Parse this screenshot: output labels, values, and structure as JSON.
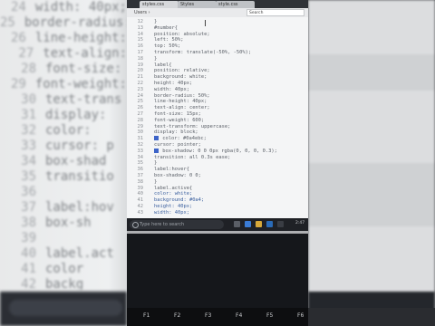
{
  "browser": {
    "tab1_label": "styles.css",
    "tab2_label": "Styles",
    "tab3_label": "style.css",
    "breadcrumb": "Users ›",
    "search_placeholder": "Search"
  },
  "editor": {
    "lines": [
      {
        "num": "12",
        "text": "}",
        "highlight": false,
        "swatch": false
      },
      {
        "num": "13",
        "text": "#number{",
        "highlight": false,
        "swatch": false
      },
      {
        "num": "14",
        "text": "  position: absolute;",
        "highlight": false,
        "swatch": false
      },
      {
        "num": "15",
        "text": "  left: 50%;",
        "highlight": false,
        "swatch": false
      },
      {
        "num": "16",
        "text": "  top: 50%;",
        "highlight": false,
        "swatch": false
      },
      {
        "num": "17",
        "text": "  transform: translate(-50%, -50%);",
        "highlight": false,
        "swatch": false
      },
      {
        "num": "18",
        "text": "}",
        "highlight": false,
        "swatch": false
      },
      {
        "num": "19",
        "text": "label{",
        "highlight": false,
        "swatch": false
      },
      {
        "num": "20",
        "text": "  position: relative;",
        "highlight": false,
        "swatch": false
      },
      {
        "num": "21",
        "text": "  background: white;",
        "highlight": false,
        "swatch": false
      },
      {
        "num": "22",
        "text": "  height: 40px;",
        "highlight": false,
        "swatch": false
      },
      {
        "num": "23",
        "text": "  width: 40px;",
        "highlight": false,
        "swatch": false
      },
      {
        "num": "24",
        "text": "  border-radius: 50%;",
        "highlight": false,
        "swatch": false
      },
      {
        "num": "25",
        "text": "  line-height: 40px;",
        "highlight": false,
        "swatch": false
      },
      {
        "num": "26",
        "text": "  text-align: center;",
        "highlight": false,
        "swatch": false
      },
      {
        "num": "27",
        "text": "  font-size: 15px;",
        "highlight": false,
        "swatch": false
      },
      {
        "num": "28",
        "text": "  font-weight: 600;",
        "highlight": false,
        "swatch": false
      },
      {
        "num": "29",
        "text": "  text-transform: uppercase;",
        "highlight": false,
        "swatch": false
      },
      {
        "num": "30",
        "text": "  display: block;",
        "highlight": false,
        "swatch": false
      },
      {
        "num": "31",
        "text": "  color: #0a4ebc;",
        "highlight": false,
        "swatch": true
      },
      {
        "num": "32",
        "text": "  cursor: pointer;",
        "highlight": false,
        "swatch": false
      },
      {
        "num": "33",
        "text": "  box-shadow: 0 0 0px rgba(0, 0, 0, 0.3);",
        "highlight": false,
        "swatch": true
      },
      {
        "num": "34",
        "text": "  transition: all 0.3s ease;",
        "highlight": false,
        "swatch": false
      },
      {
        "num": "35",
        "text": "}",
        "highlight": false,
        "swatch": false
      },
      {
        "num": "36",
        "text": "label:hover{",
        "highlight": false,
        "swatch": false
      },
      {
        "num": "37",
        "text": "  box-shadow: 0 0;",
        "highlight": false,
        "swatch": false
      },
      {
        "num": "38",
        "text": "}",
        "highlight": false,
        "swatch": false
      },
      {
        "num": "39",
        "text": "label.active{",
        "highlight": false,
        "swatch": false
      },
      {
        "num": "40",
        "text": "  color: white;",
        "highlight": true,
        "swatch": false
      },
      {
        "num": "41",
        "text": "  background: #0a4;",
        "highlight": true,
        "swatch": false
      },
      {
        "num": "42",
        "text": "  height: 40px;",
        "highlight": true,
        "swatch": false
      },
      {
        "num": "43",
        "text": "  width: 40px;",
        "highlight": true,
        "swatch": false
      }
    ]
  },
  "background_code": {
    "lines": [
      {
        "num": "24",
        "text": "width: 40px;"
      },
      {
        "num": "25",
        "text": "border-radius:"
      },
      {
        "num": "26",
        "text": "line-height:"
      },
      {
        "num": "27",
        "text": "text-align:"
      },
      {
        "num": "28",
        "text": "font-size:"
      },
      {
        "num": "29",
        "text": "font-weight:"
      },
      {
        "num": "30",
        "text": "text-trans"
      },
      {
        "num": "31",
        "text": "display:"
      },
      {
        "num": "32",
        "text": "color: "
      },
      {
        "num": "33",
        "text": "cursor: p"
      },
      {
        "num": "34",
        "text": "box-shad"
      },
      {
        "num": "35",
        "text": "transitio"
      },
      {
        "num": "36",
        "text": ""
      },
      {
        "num": "37",
        "text": "label:hov"
      },
      {
        "num": "38",
        "text": "  box-sh"
      },
      {
        "num": "39",
        "text": ""
      },
      {
        "num": "40",
        "text": "label.act"
      },
      {
        "num": "41",
        "text": "  color"
      },
      {
        "num": "42",
        "text": "  backg"
      },
      {
        "num": "43",
        "text": "  heig"
      }
    ]
  },
  "taskbar": {
    "search_text": "Type here to search",
    "time": "2:47"
  },
  "fn_keys": [
    "F1",
    "F2",
    "F3",
    "F4",
    "F5",
    "F6"
  ],
  "colors": {
    "swatch_blue": "#3d64c8",
    "editor_bg": "#f4f5f6",
    "taskbar_bg": "#1f2126"
  }
}
